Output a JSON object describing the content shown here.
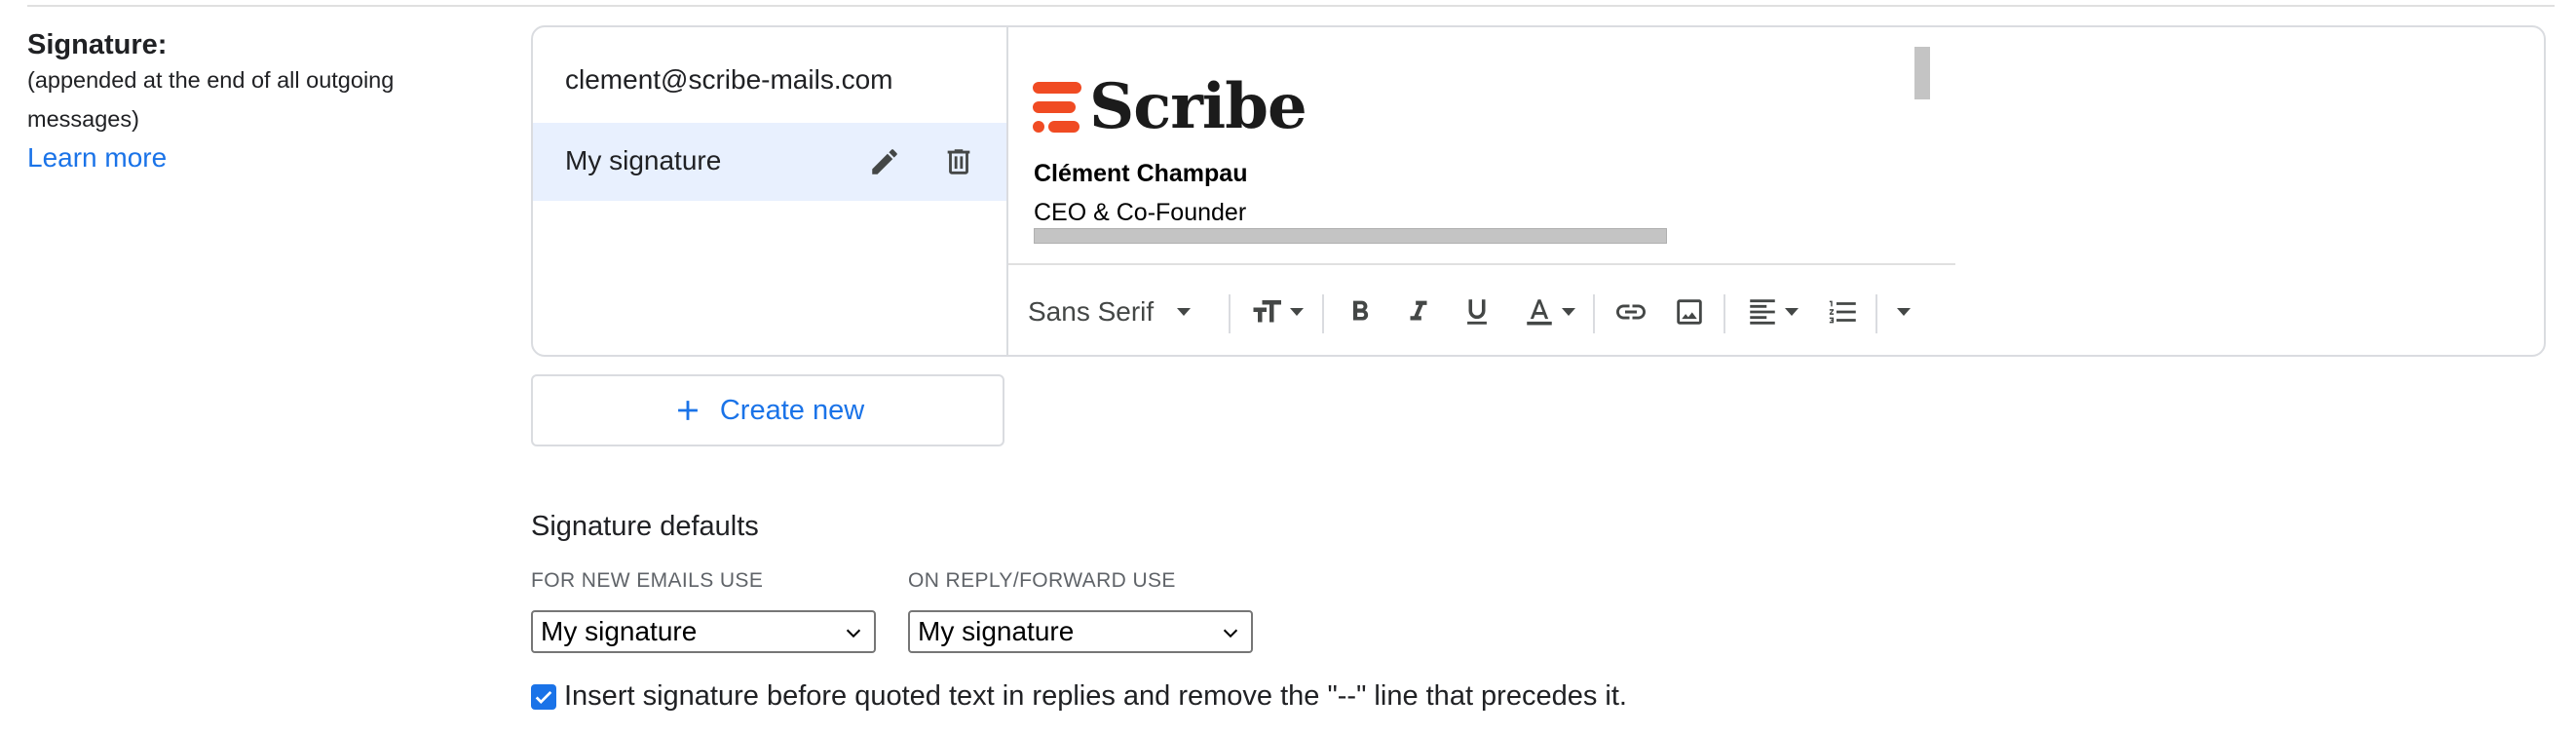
{
  "signature_section": {
    "title": "Signature:",
    "description": "(appended at the end of all outgoing messages)",
    "learn_more": "Learn more"
  },
  "signature_list": {
    "account_email": "clement@scribe-mails.com",
    "items": [
      {
        "label": "My signature",
        "selected": true
      }
    ]
  },
  "editor": {
    "logo_text": "Scribe",
    "signature_name": "Clément Champau",
    "signature_title": "CEO & Co-Founder",
    "toolbar": {
      "font_family": "Sans Serif"
    },
    "colors": {
      "brand": "#f04b23",
      "selection_bg": "#e8f0fe",
      "accent": "#1a73e8"
    }
  },
  "create_new": {
    "label": "Create new"
  },
  "defaults": {
    "title": "Signature defaults",
    "new_emails_label": "FOR NEW EMAILS USE",
    "new_emails_value": "My signature",
    "reply_forward_label": "ON REPLY/FORWARD USE",
    "reply_forward_value": "My signature"
  },
  "insert_before_quoted": {
    "checked": true,
    "label": "Insert signature before quoted text in replies and remove the \"--\" line that precedes it."
  }
}
